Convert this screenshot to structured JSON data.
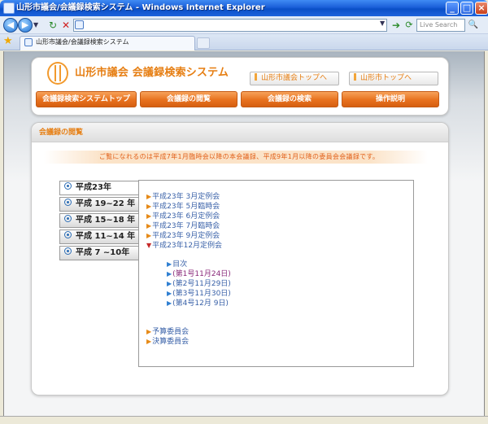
{
  "window": {
    "title": "山形市議会/会議録検索システム - Windows Internet Explorer",
    "minimize": "_",
    "maximize": "□",
    "close": "×"
  },
  "browser": {
    "search_placeholder": "Live Search",
    "tab_label": "山形市議会/会議録検索システム",
    "address_value": ""
  },
  "header": {
    "site_title": "山形市議会 会議録検索システム",
    "links": [
      "山形市議会トップへ",
      "山形市トップへ"
    ],
    "nav_tabs": [
      "会議録検索システムトップ",
      "会議録の閲覧",
      "会議録の検索",
      "操作説明"
    ]
  },
  "content": {
    "section_title": "会議録の閲覧",
    "notice": "ご覧になれるのは平成7年1月臨時会以降の本会議録、平成9年1月以降の委員会会議録です。",
    "year_tabs": [
      "平成23年",
      "平成 19~22 年",
      "平成 15~18 年",
      "平成 11~14 年",
      "平成 7 ~10年"
    ],
    "sessions": [
      "平成23年 3月定例会",
      "平成23年 5月臨時会",
      "平成23年 6月定例会",
      "平成23年 7月臨時会",
      "平成23年 9月定例会",
      "平成23年12月定例会"
    ],
    "sub_items": [
      "目次",
      "(第1号11月24日)",
      "(第2号11月29日)",
      "(第3号11月30日)",
      "(第4号12月 9日)"
    ],
    "committees": [
      "予算委員会",
      "決算委員会"
    ]
  },
  "colors": {
    "accent_orange": "#e67e12",
    "link_blue": "#3961a8",
    "visited_purple": "#8a2a7a",
    "titlebar_blue": "#1b5fd9"
  },
  "icons": {
    "collapsed_marker": "triangle-right-icon",
    "expanded_marker": "triangle-down-icon",
    "year_marker": "circle-dot-icon"
  }
}
